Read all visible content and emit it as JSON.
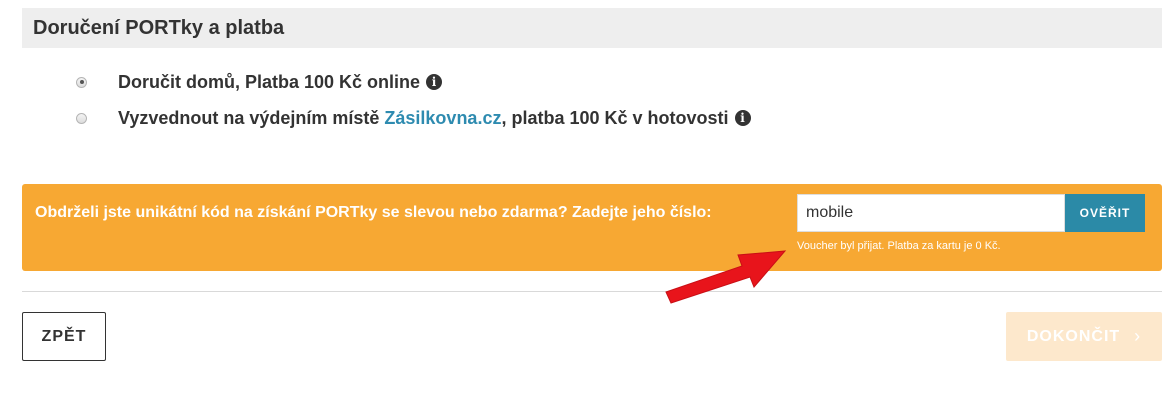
{
  "section": {
    "title": "Doručení PORTky a platba"
  },
  "delivery": {
    "options": [
      {
        "label": "Doručit domů, Platba 100 Kč online",
        "selected": true
      },
      {
        "label_before": "Vyzvednout na výdejním místě ",
        "link": "Zásilkovna.cz",
        "label_after": ", platba 100 Kč v hotovosti",
        "selected": false
      }
    ],
    "info_glyph": "i"
  },
  "voucher": {
    "prompt": "Obdrželi jste unikátní kód na získání PORTky se slevou nebo zdarma? Zadejte jeho číslo:",
    "input_value": "mobile",
    "verify_label": "OVĚŘIT",
    "status": "Voucher byl přijat. Platba za kartu je 0 Kč."
  },
  "nav": {
    "back_label": "ZPĚT",
    "finish_label": "DOKONČIT",
    "finish_chevron": "›"
  },
  "colors": {
    "voucher_background": "#f7a833",
    "verify_button": "#2b8aa7",
    "link": "#2e8bb0",
    "finish_disabled": "#fde8cc",
    "annotation_arrow": "#e8141b"
  },
  "icons": {
    "info": "info-icon",
    "chevron": "chevron-right-icon",
    "annotation": "red-arrow-icon"
  }
}
